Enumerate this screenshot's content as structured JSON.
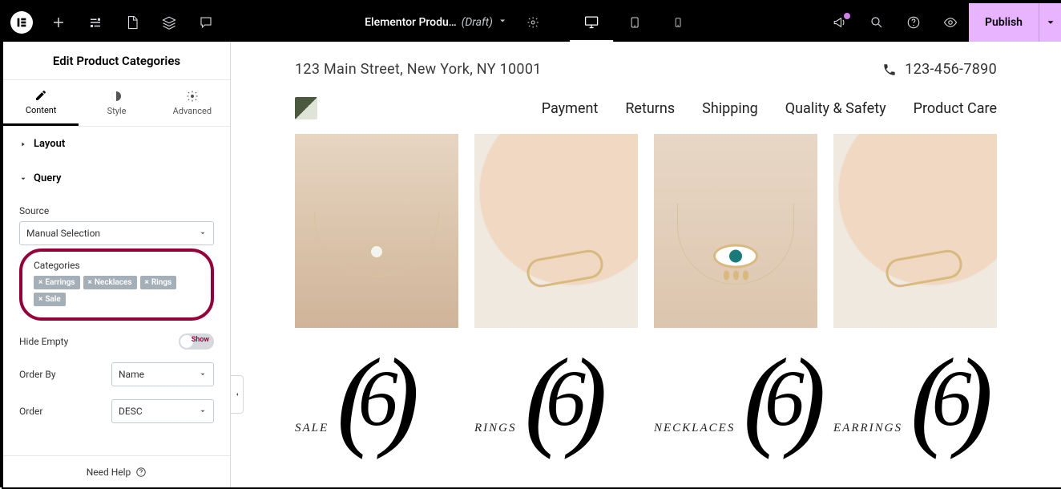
{
  "topbar": {
    "doc_title": "Elementor Produ…",
    "draft_label": "(Draft)",
    "publish_label": "Publish"
  },
  "sidebar": {
    "panel_title": "Edit Product Categories",
    "tabs": {
      "content": "Content",
      "style": "Style",
      "advanced": "Advanced"
    },
    "sections": {
      "layout_title": "Layout",
      "query_title": "Query"
    },
    "query": {
      "source_label": "Source",
      "source_value": "Manual Selection",
      "categories_label": "Categories",
      "chips": [
        "Earrings",
        "Necklaces",
        "Rings",
        "Sale"
      ],
      "hide_empty_label": "Hide Empty",
      "hide_empty_toggle": "Show",
      "order_by_label": "Order By",
      "order_by_value": "Name",
      "order_label": "Order",
      "order_value": "DESC"
    },
    "footer_help": "Need Help"
  },
  "preview": {
    "address": "123 Main Street, New York, NY 10001",
    "phone": "123-456-7890",
    "nav": [
      "Payment",
      "Returns",
      "Shipping",
      "Quality & Safety",
      "Product Care"
    ],
    "categories": [
      {
        "label": "SALE",
        "count": "6"
      },
      {
        "label": "RINGS",
        "count": "6"
      },
      {
        "label": "NECKLACES",
        "count": "6"
      },
      {
        "label": "EARRINGS",
        "count": "6"
      }
    ]
  }
}
